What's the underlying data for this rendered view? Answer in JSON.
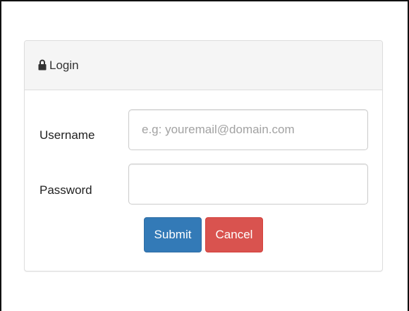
{
  "panel": {
    "title": "Login",
    "title_icon": "lock-icon"
  },
  "form": {
    "username_label": "Username",
    "username_value": "",
    "username_placeholder": "e.g: youremail@domain.com",
    "password_label": "Password",
    "password_value": "",
    "password_placeholder": ""
  },
  "buttons": {
    "submit_label": "Submit",
    "cancel_label": "Cancel"
  },
  "colors": {
    "primary": "#337ab7",
    "danger": "#d9534f",
    "heading_bg": "#f5f5f5"
  }
}
